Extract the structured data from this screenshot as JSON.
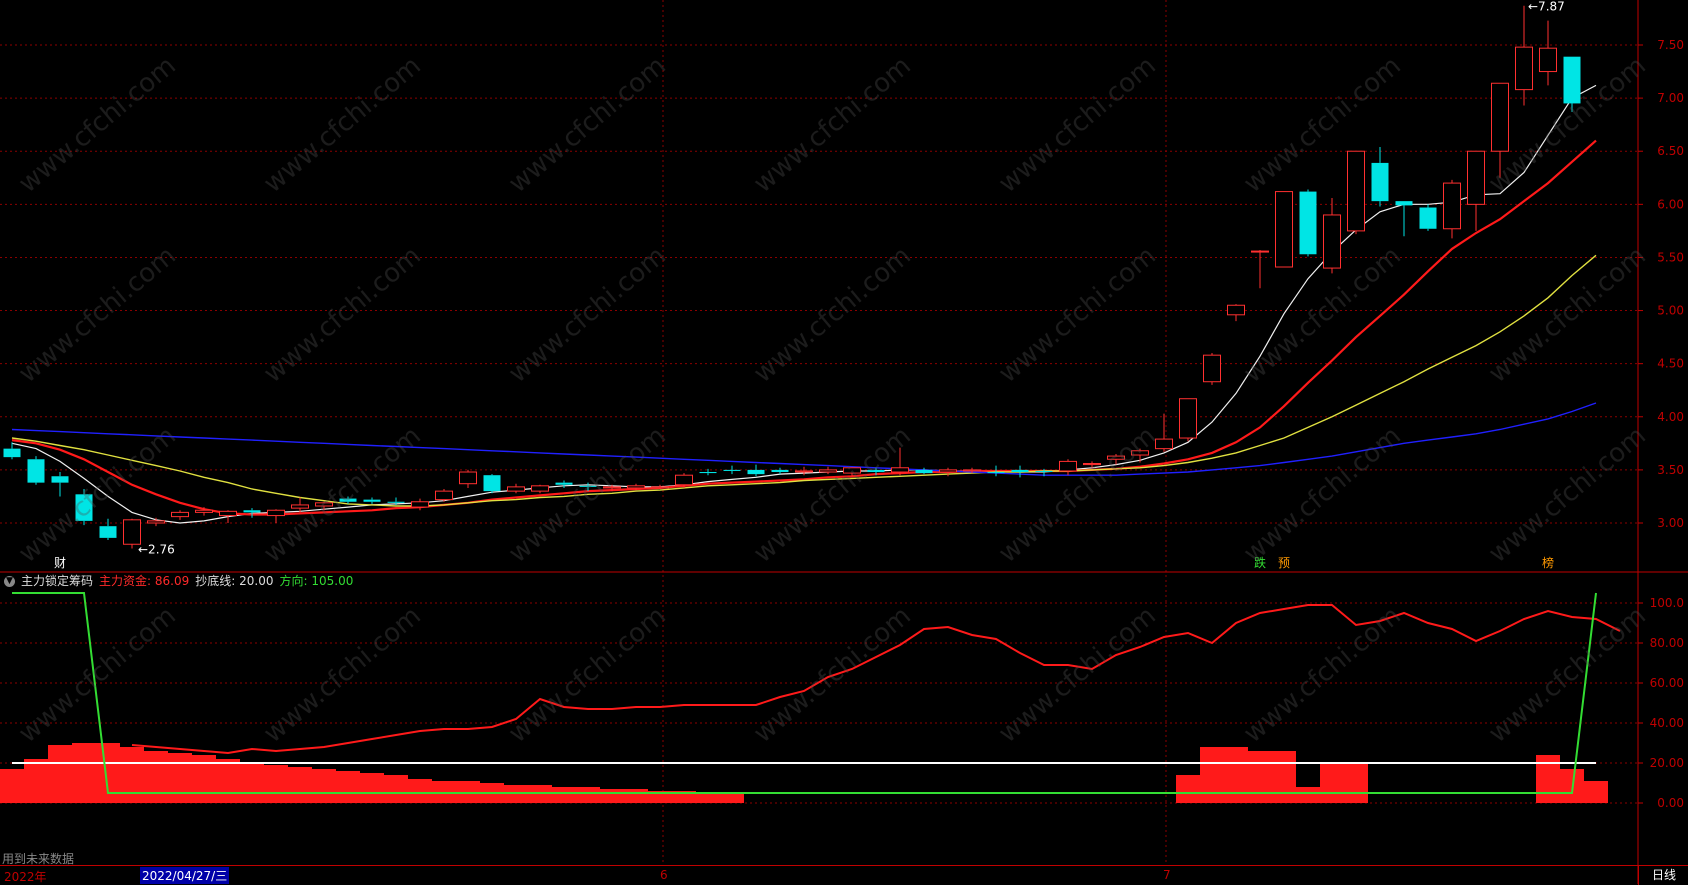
{
  "colors": {
    "up": "#ff3030",
    "down": "#00e5e5",
    "ma5": "#f0f0f0",
    "ma10": "#ff1a1a",
    "ma20": "#e0e040",
    "ma60": "#2020ff",
    "grid": "#8b0000",
    "axis": "#c00000",
    "fund": "#ff1a1a",
    "dir": "#33dd33",
    "bottom": "#ffffff"
  },
  "price_panel": {
    "y_ticks": [
      "7.50",
      "7.00",
      "6.50",
      "6.00",
      "5.50",
      "5.00",
      "4.50",
      "4.00",
      "3.50",
      "3.00"
    ],
    "high_label": "7.87",
    "low_label": "2.76",
    "markers": [
      {
        "text": "财",
        "color": "#ffffff"
      },
      {
        "text": "跌",
        "color": "#33dd33"
      },
      {
        "text": "预",
        "color": "#ff9900"
      },
      {
        "text": "榜",
        "color": "#ff9900"
      }
    ]
  },
  "indicator_panel": {
    "name": "主力锁定筹码",
    "fund_label": "主力资金:",
    "fund_value": "86.09",
    "bottom_label": "抄底线:",
    "bottom_value": "20.00",
    "dir_label": "方向:",
    "dir_value": "105.00",
    "y_ticks": [
      "100.0",
      "80.00",
      "60.00",
      "40.00",
      "20.00",
      "0.00"
    ]
  },
  "footer": {
    "future_note": "用到未来数据",
    "x_labels": [
      "2022年",
      "6",
      "7"
    ],
    "cursor_date": "2022/04/27/三",
    "period": "日线"
  },
  "chart_data": [
    {
      "type": "candlestick",
      "title": "",
      "ylim": [
        2.6,
        7.9
      ],
      "grid": true,
      "candles": [
        {
          "o": 3.7,
          "h": 3.76,
          "l": 3.6,
          "c": 3.62
        },
        {
          "o": 3.6,
          "h": 3.63,
          "l": 3.36,
          "c": 3.38
        },
        {
          "o": 3.44,
          "h": 3.48,
          "l": 3.25,
          "c": 3.38
        },
        {
          "o": 3.27,
          "h": 3.32,
          "l": 2.98,
          "c": 3.02
        },
        {
          "o": 2.97,
          "h": 3.04,
          "l": 2.84,
          "c": 2.86
        },
        {
          "o": 2.8,
          "h": 3.04,
          "l": 2.76,
          "c": 3.03
        },
        {
          "o": 3.0,
          "h": 3.05,
          "l": 2.97,
          "c": 3.02
        },
        {
          "o": 3.06,
          "h": 3.12,
          "l": 3.03,
          "c": 3.1
        },
        {
          "o": 3.1,
          "h": 3.15,
          "l": 3.07,
          "c": 3.12
        },
        {
          "o": 3.07,
          "h": 3.12,
          "l": 3.0,
          "c": 3.11
        },
        {
          "o": 3.12,
          "h": 3.14,
          "l": 3.05,
          "c": 3.1
        },
        {
          "o": 3.07,
          "h": 3.13,
          "l": 3.0,
          "c": 3.12
        },
        {
          "o": 3.14,
          "h": 3.24,
          "l": 3.1,
          "c": 3.17
        },
        {
          "o": 3.16,
          "h": 3.2,
          "l": 3.12,
          "c": 3.19
        },
        {
          "o": 3.23,
          "h": 3.25,
          "l": 3.18,
          "c": 3.2
        },
        {
          "o": 3.22,
          "h": 3.24,
          "l": 3.18,
          "c": 3.2
        },
        {
          "o": 3.2,
          "h": 3.24,
          "l": 3.17,
          "c": 3.19
        },
        {
          "o": 3.15,
          "h": 3.23,
          "l": 3.12,
          "c": 3.2
        },
        {
          "o": 3.22,
          "h": 3.32,
          "l": 3.2,
          "c": 3.3
        },
        {
          "o": 3.37,
          "h": 3.5,
          "l": 3.33,
          "c": 3.48
        },
        {
          "o": 3.45,
          "h": 3.46,
          "l": 3.28,
          "c": 3.3
        },
        {
          "o": 3.3,
          "h": 3.37,
          "l": 3.28,
          "c": 3.34
        },
        {
          "o": 3.3,
          "h": 3.36,
          "l": 3.28,
          "c": 3.35
        },
        {
          "o": 3.38,
          "h": 3.4,
          "l": 3.33,
          "c": 3.36
        },
        {
          "o": 3.35,
          "h": 3.38,
          "l": 3.3,
          "c": 3.34
        },
        {
          "o": 3.33,
          "h": 3.36,
          "l": 3.3,
          "c": 3.34
        },
        {
          "o": 3.33,
          "h": 3.37,
          "l": 3.31,
          "c": 3.35
        },
        {
          "o": 3.33,
          "h": 3.36,
          "l": 3.32,
          "c": 3.34
        },
        {
          "o": 3.36,
          "h": 3.47,
          "l": 3.33,
          "c": 3.45
        },
        {
          "o": 3.48,
          "h": 3.51,
          "l": 3.45,
          "c": 3.47
        },
        {
          "o": 3.5,
          "h": 3.54,
          "l": 3.46,
          "c": 3.49
        },
        {
          "o": 3.5,
          "h": 3.55,
          "l": 3.44,
          "c": 3.46
        },
        {
          "o": 3.5,
          "h": 3.52,
          "l": 3.46,
          "c": 3.48
        },
        {
          "o": 3.48,
          "h": 3.53,
          "l": 3.45,
          "c": 3.49
        },
        {
          "o": 3.48,
          "h": 3.53,
          "l": 3.46,
          "c": 3.5
        },
        {
          "o": 3.47,
          "h": 3.51,
          "l": 3.44,
          "c": 3.52
        },
        {
          "o": 3.5,
          "h": 3.52,
          "l": 3.45,
          "c": 3.48
        },
        {
          "o": 3.48,
          "h": 3.71,
          "l": 3.45,
          "c": 3.52
        },
        {
          "o": 3.5,
          "h": 3.52,
          "l": 3.46,
          "c": 3.47
        },
        {
          "o": 3.48,
          "h": 3.52,
          "l": 3.44,
          "c": 3.5
        },
        {
          "o": 3.49,
          "h": 3.52,
          "l": 3.47,
          "c": 3.5
        },
        {
          "o": 3.48,
          "h": 3.54,
          "l": 3.44,
          "c": 3.47
        },
        {
          "o": 3.5,
          "h": 3.54,
          "l": 3.43,
          "c": 3.48
        },
        {
          "o": 3.49,
          "h": 3.51,
          "l": 3.44,
          "c": 3.48
        },
        {
          "o": 3.49,
          "h": 3.6,
          "l": 3.45,
          "c": 3.58
        },
        {
          "o": 3.55,
          "h": 3.58,
          "l": 3.52,
          "c": 3.56
        },
        {
          "o": 3.6,
          "h": 3.65,
          "l": 3.55,
          "c": 3.63
        },
        {
          "o": 3.64,
          "h": 3.7,
          "l": 3.57,
          "c": 3.68
        },
        {
          "o": 3.7,
          "h": 4.03,
          "l": 3.67,
          "c": 3.79
        },
        {
          "o": 3.8,
          "h": 4.17,
          "l": 3.77,
          "c": 4.17
        },
        {
          "o": 4.33,
          "h": 4.6,
          "l": 4.3,
          "c": 4.58
        },
        {
          "o": 4.96,
          "h": 5.06,
          "l": 4.9,
          "c": 5.05
        },
        {
          "o": 5.56,
          "h": 5.57,
          "l": 5.21,
          "c": 5.56
        },
        {
          "o": 5.41,
          "h": 6.12,
          "l": 5.41,
          "c": 6.12
        },
        {
          "o": 6.12,
          "h": 6.14,
          "l": 5.51,
          "c": 5.53
        },
        {
          "o": 5.4,
          "h": 6.06,
          "l": 5.35,
          "c": 5.9
        },
        {
          "o": 5.75,
          "h": 6.5,
          "l": 5.72,
          "c": 6.5
        },
        {
          "o": 6.39,
          "h": 6.54,
          "l": 5.98,
          "c": 6.03
        },
        {
          "o": 6.03,
          "h": 6.03,
          "l": 5.7,
          "c": 5.99
        },
        {
          "o": 5.97,
          "h": 6.0,
          "l": 5.75,
          "c": 5.77
        },
        {
          "o": 5.77,
          "h": 6.23,
          "l": 5.68,
          "c": 6.2
        },
        {
          "o": 6.0,
          "h": 6.5,
          "l": 5.75,
          "c": 6.5
        },
        {
          "o": 6.5,
          "h": 7.14,
          "l": 6.25,
          "c": 7.14
        },
        {
          "o": 7.08,
          "h": 7.87,
          "l": 6.93,
          "c": 7.48
        },
        {
          "o": 7.25,
          "h": 7.73,
          "l": 7.12,
          "c": 7.47
        },
        {
          "o": 7.39,
          "h": 7.39,
          "l": 6.87,
          "c": 6.95
        }
      ],
      "series": [
        {
          "name": "MA5",
          "values": [
            3.75,
            3.7,
            3.58,
            3.42,
            3.25,
            3.1,
            3.03,
            3.0,
            3.02,
            3.06,
            3.09,
            3.1,
            3.11,
            3.13,
            3.15,
            3.17,
            3.18,
            3.19,
            3.21,
            3.25,
            3.29,
            3.31,
            3.33,
            3.35,
            3.36,
            3.35,
            3.34,
            3.34,
            3.36,
            3.39,
            3.41,
            3.43,
            3.46,
            3.47,
            3.48,
            3.49,
            3.49,
            3.5,
            3.5,
            3.49,
            3.49,
            3.49,
            3.48,
            3.48,
            3.5,
            3.52,
            3.55,
            3.59,
            3.66,
            3.76,
            3.95,
            4.22,
            4.57,
            4.97,
            5.3,
            5.55,
            5.76,
            5.93,
            6.0,
            6.0,
            6.02,
            6.09,
            6.1,
            6.3,
            6.65,
            7.0,
            7.12
          ]
        },
        {
          "name": "MA10",
          "values": [
            3.78,
            3.75,
            3.69,
            3.6,
            3.48,
            3.36,
            3.27,
            3.19,
            3.13,
            3.09,
            3.08,
            3.08,
            3.09,
            3.1,
            3.11,
            3.12,
            3.14,
            3.15,
            3.17,
            3.19,
            3.22,
            3.24,
            3.26,
            3.28,
            3.3,
            3.31,
            3.32,
            3.33,
            3.35,
            3.37,
            3.38,
            3.39,
            3.4,
            3.41,
            3.43,
            3.44,
            3.46,
            3.47,
            3.48,
            3.48,
            3.49,
            3.49,
            3.49,
            3.49,
            3.49,
            3.5,
            3.51,
            3.53,
            3.56,
            3.6,
            3.66,
            3.76,
            3.9,
            4.1,
            4.32,
            4.53,
            4.75,
            4.95,
            5.15,
            5.37,
            5.58,
            5.73,
            5.86,
            6.03,
            6.2,
            6.4,
            6.6
          ]
        },
        {
          "name": "MA20",
          "values": [
            3.8,
            3.77,
            3.73,
            3.69,
            3.64,
            3.59,
            3.54,
            3.49,
            3.43,
            3.38,
            3.32,
            3.28,
            3.24,
            3.21,
            3.18,
            3.17,
            3.16,
            3.16,
            3.17,
            3.19,
            3.21,
            3.22,
            3.24,
            3.25,
            3.27,
            3.28,
            3.3,
            3.31,
            3.33,
            3.35,
            3.36,
            3.37,
            3.38,
            3.4,
            3.41,
            3.42,
            3.43,
            3.44,
            3.45,
            3.46,
            3.47,
            3.48,
            3.48,
            3.49,
            3.49,
            3.5,
            3.51,
            3.52,
            3.54,
            3.57,
            3.61,
            3.66,
            3.73,
            3.8,
            3.9,
            4.0,
            4.11,
            4.22,
            4.33,
            4.45,
            4.56,
            4.67,
            4.8,
            4.95,
            5.12,
            5.33,
            5.52
          ]
        },
        {
          "name": "MA60",
          "values": [
            3.88,
            3.87,
            3.86,
            3.85,
            3.84,
            3.83,
            3.82,
            3.81,
            3.8,
            3.79,
            3.78,
            3.77,
            3.76,
            3.75,
            3.74,
            3.73,
            3.72,
            3.71,
            3.7,
            3.69,
            3.68,
            3.67,
            3.66,
            3.65,
            3.64,
            3.63,
            3.62,
            3.61,
            3.6,
            3.59,
            3.58,
            3.57,
            3.56,
            3.55,
            3.54,
            3.53,
            3.52,
            3.51,
            3.5,
            3.49,
            3.48,
            3.47,
            3.46,
            3.45,
            3.45,
            3.45,
            3.45,
            3.46,
            3.47,
            3.48,
            3.5,
            3.52,
            3.54,
            3.57,
            3.6,
            3.63,
            3.67,
            3.71,
            3.75,
            3.78,
            3.81,
            3.84,
            3.88,
            3.93,
            3.98,
            4.05,
            4.13
          ]
        }
      ]
    },
    {
      "type": "bar",
      "title": "主力锁定筹码",
      "ylim": [
        -20,
        110
      ],
      "series": [
        {
          "name": "主力资金",
          "type": "line",
          "values": [
            null,
            null,
            null,
            null,
            null,
            29,
            28,
            27,
            26,
            25,
            27,
            26,
            27,
            28,
            30,
            32,
            34,
            36,
            37,
            37,
            38,
            42,
            52,
            48,
            47,
            47,
            48,
            48,
            49,
            49,
            49,
            49,
            53,
            56,
            63,
            67,
            73,
            79,
            87,
            88,
            84,
            82,
            75,
            69,
            69,
            67,
            74,
            78,
            83,
            85,
            80,
            90,
            95,
            97,
            99,
            99,
            89,
            91,
            95,
            90,
            87,
            81,
            86,
            92,
            96,
            93,
            92,
            86
          ]
        },
        {
          "name": "抄底线",
          "type": "line",
          "values": [
            20
          ]
        },
        {
          "name": "方向",
          "type": "line",
          "values": [
            105,
            105,
            105,
            105,
            5,
            5,
            5,
            5,
            5,
            5,
            5,
            5,
            5,
            5,
            5,
            5,
            5,
            5,
            5,
            5,
            5,
            5,
            5,
            5,
            5,
            5,
            5,
            5,
            5,
            5,
            5,
            5,
            5,
            5,
            5,
            5,
            5,
            5,
            5,
            5,
            5,
            5,
            5,
            5,
            5,
            5,
            5,
            5,
            5,
            5,
            5,
            5,
            5,
            5,
            5,
            5,
            5,
            5,
            5,
            5,
            5,
            5,
            5,
            5,
            5,
            5,
            105
          ]
        },
        {
          "name": "红柱",
          "type": "bar",
          "values": [
            17,
            22,
            29,
            30,
            30,
            28,
            26,
            25,
            24,
            22,
            20,
            19,
            18,
            17,
            16,
            15,
            14,
            12,
            11,
            11,
            10,
            9,
            9,
            8,
            8,
            7,
            7,
            6,
            6,
            5,
            5,
            0,
            0,
            0,
            0,
            0,
            0,
            0,
            0,
            0,
            0,
            0,
            0,
            0,
            0,
            0,
            0,
            0,
            0,
            14,
            28,
            28,
            26,
            26,
            8,
            20,
            20,
            0,
            0,
            0,
            0,
            0,
            0,
            0,
            24,
            17,
            11
          ]
        }
      ]
    }
  ]
}
